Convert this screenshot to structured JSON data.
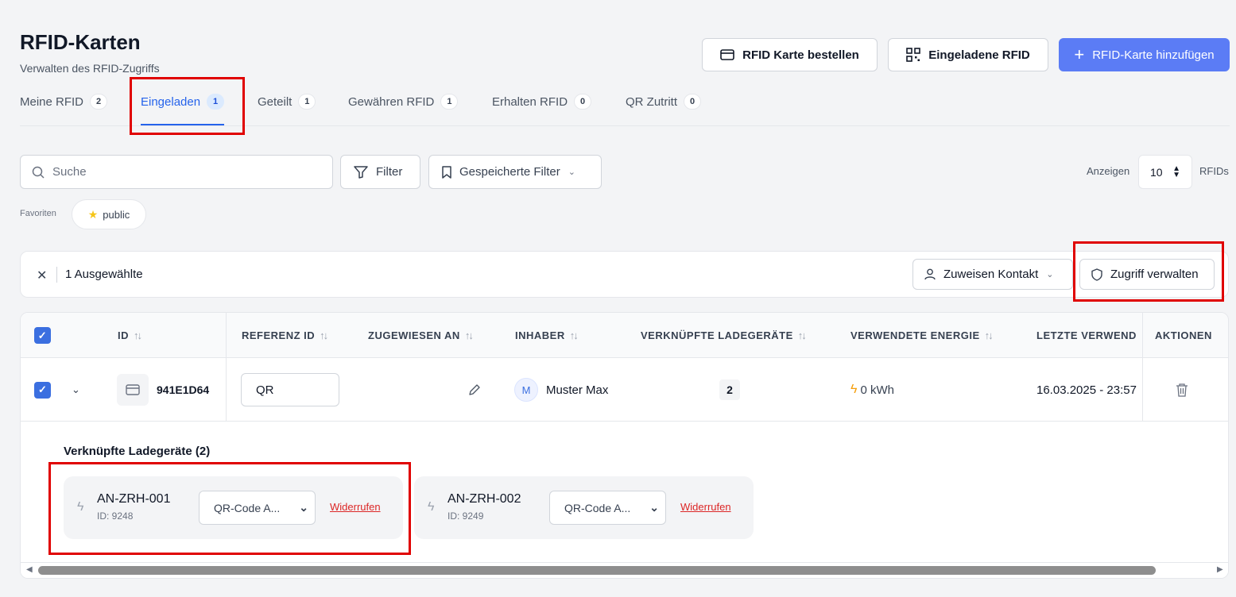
{
  "header": {
    "title": "RFID-Karten",
    "subtitle": "Verwalten des RFID-Zugriffs",
    "order_button": "RFID Karte bestellen",
    "invited_button": "Eingeladene RFID",
    "add_button": "RFID-Karte hinzufügen"
  },
  "tabs": [
    {
      "label": "Meine RFID",
      "count": "2"
    },
    {
      "label": "Eingeladen",
      "count": "1"
    },
    {
      "label": "Geteilt",
      "count": "1"
    },
    {
      "label": "Gewähren RFID",
      "count": "1"
    },
    {
      "label": "Erhalten RFID",
      "count": "0"
    },
    {
      "label": "QR Zutritt",
      "count": "0"
    }
  ],
  "toolbar": {
    "search_placeholder": "Suche",
    "filter_label": "Filter",
    "saved_filter_label": "Gespeicherte Filter",
    "show_label": "Anzeigen",
    "page_size": "10",
    "unit_label": "RFIDs"
  },
  "favorites": {
    "label": "Favoriten",
    "chip": "public"
  },
  "selection": {
    "text": "1 Ausgewählte",
    "assign_contact": "Zuweisen Kontakt",
    "manage_access": "Zugriff verwalten"
  },
  "table": {
    "columns": [
      "ID",
      "REFERENZ ID",
      "ZUGEWIESEN AN",
      "INHABER",
      "VERKNÜPFTE LADEGERÄTE",
      "VERWENDETE ENERGIE",
      "LETZTE VERWEND",
      "AKTIONEN"
    ],
    "row": {
      "id": "941E1D64",
      "reference": "QR",
      "owner_initial": "M",
      "owner": "Muster Max",
      "chargers": "2",
      "energy": "0 kWh",
      "last_used": "16.03.2025 - 23:57"
    }
  },
  "linked": {
    "title": "Verknüpfte Ladegeräte (2)",
    "items": [
      {
        "name": "AN-ZRH-001",
        "id": "ID: 9248",
        "mode": "QR-Code A...",
        "revoke": "Widerrufen"
      },
      {
        "name": "AN-ZRH-002",
        "id": "ID: 9249",
        "mode": "QR-Code A...",
        "revoke": "Widerrufen"
      }
    ]
  },
  "colors": {
    "accent": "#5b7cf5",
    "active_tab": "#2563eb",
    "highlight": "#e00000",
    "danger": "#dc2626"
  }
}
